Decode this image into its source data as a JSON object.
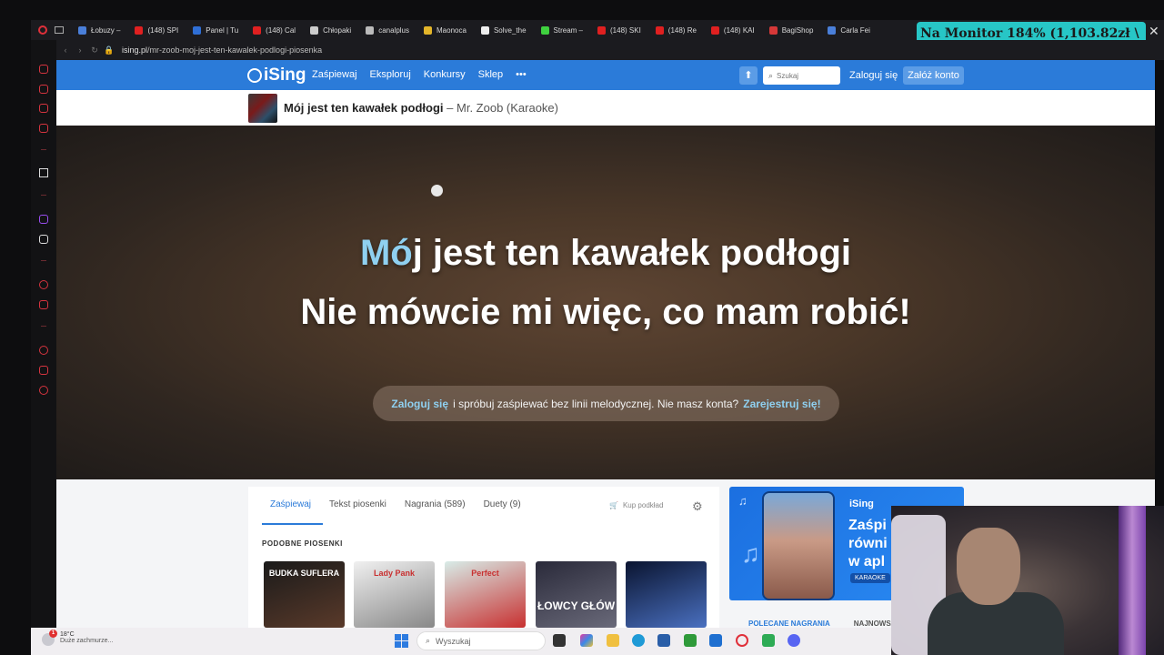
{
  "browser": {
    "tabs": [
      {
        "label": "Łobuzy –",
        "color": "#4a7fd9"
      },
      {
        "label": "(148) SPI",
        "color": "#e02020"
      },
      {
        "label": "Panel | Tu",
        "color": "#2f6fd6"
      },
      {
        "label": "(148) Cal",
        "color": "#e02020"
      },
      {
        "label": "Chłopaki",
        "color": "#cccccc"
      },
      {
        "label": "canalplus",
        "color": "#bbbbbb"
      },
      {
        "label": "Maonoca",
        "color": "#e3b52a"
      },
      {
        "label": "Solve_the",
        "color": "#eeeeee"
      },
      {
        "label": "Stream –",
        "color": "#3fd13f"
      },
      {
        "label": "(148) SKI",
        "color": "#e02020"
      },
      {
        "label": "(148) Re",
        "color": "#e02020"
      },
      {
        "label": "(148) KAI",
        "color": "#e02020"
      },
      {
        "label": "BagiShop",
        "color": "#d63838"
      },
      {
        "label": "Carla Fei",
        "color": "#4a7fd9"
      }
    ],
    "url_host": "ising.pl",
    "url_path": "/mr-zoob-moj-jest-ten-kawalek-podlogi-piosenka"
  },
  "overlay": {
    "text": "Na Monitor 184% (1,103.82zł \\",
    "close": "✕"
  },
  "site": {
    "logo": "iSing",
    "nav": [
      "Zaśpiewaj",
      "Eksploruj",
      "Konkursy",
      "Sklep",
      "•••"
    ],
    "search_placeholder": "Szukaj",
    "login": "Zaloguj się",
    "register": "Załóż konto"
  },
  "song": {
    "title": "Mój jest ten kawałek podłogi",
    "artist": " – Mr. Zoob (Karaoke)"
  },
  "player": {
    "lyric1_sung": "Mó",
    "lyric1_rest": "j jest ten kawałek podłogi",
    "lyric2": "Nie mówcie mi więc, co mam robić!",
    "prompt_login": "Zaloguj się",
    "prompt_text": "i spróbuj zaśpiewać bez linii melodycznej. Nie masz konta?",
    "prompt_register": "Zarejestruj się!"
  },
  "content": {
    "tabs": [
      "Zaśpiewaj",
      "Tekst piosenki",
      "Nagrania (589)",
      "Duety (9)"
    ],
    "buy_track": "Kup podkład",
    "similar_heading": "PODOBNE PIOSENKI",
    "covers": [
      {
        "caption": "BUDKA SUFLERA",
        "colors": [
          "#1a1a1a",
          "#5a3a2a"
        ]
      },
      {
        "caption": "Lady Pank",
        "colors": [
          "#f0f0f0",
          "#888888"
        ]
      },
      {
        "caption": "Perfect",
        "colors": [
          "#d8ece8",
          "#c83030"
        ]
      },
      {
        "caption": "ŁOWCY GŁÓW",
        "colors": [
          "#2a2a3a",
          "#6a6a7a"
        ]
      },
      {
        "caption": "",
        "colors": [
          "#0a1430",
          "#4a70c0"
        ]
      }
    ]
  },
  "ad": {
    "logo": "iSing",
    "text": "Zaśpi równi w apl",
    "badge": "KARAOKE",
    "rec_tab_1": "POLECANE NAGRANIA",
    "rec_tab_2": "NAJNOWSZ"
  },
  "taskbar": {
    "temp": "18°C",
    "weather": "Duże zachmurze...",
    "badge": "1",
    "search": "Wyszukaj"
  }
}
